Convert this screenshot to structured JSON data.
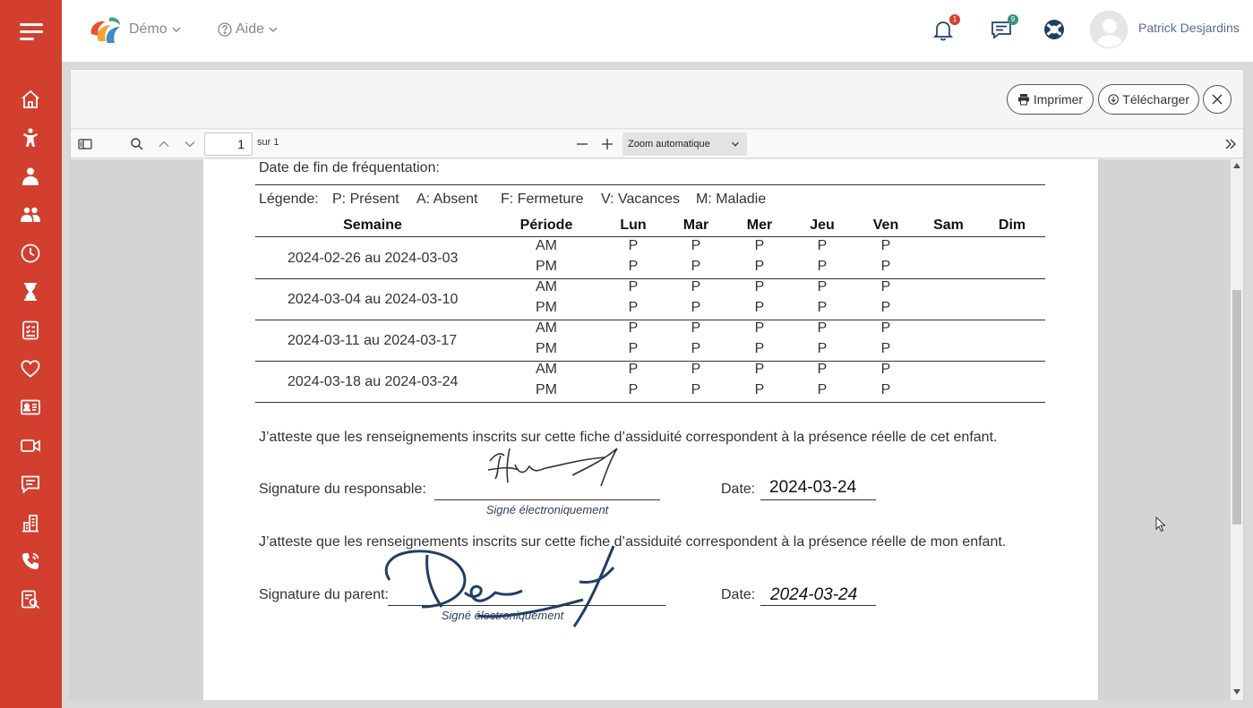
{
  "header": {
    "demo_label": "Démo",
    "help_label": "Aide",
    "notifications_badge": "1",
    "messages_badge": "9",
    "user_name": "Patrick Desjardins"
  },
  "viewer": {
    "print_label": "Imprimer",
    "download_label": "Télécharger",
    "page_number": "1",
    "page_of": "sur 1",
    "zoom_value": "Zoom automatique"
  },
  "document": {
    "end_date_label": "Date de fin de fréquentation:",
    "legend": [
      "Légende:",
      "P: Présent",
      "A: Absent",
      "F: Fermeture",
      "V: Vacances",
      "M: Maladie"
    ],
    "columns": [
      "Semaine",
      "Période",
      "Lun",
      "Mar",
      "Mer",
      "Jeu",
      "Ven",
      "Sam",
      "Dim"
    ],
    "weeks": [
      {
        "label": "2024-02-26 au 2024-03-03",
        "rows": [
          [
            "AM",
            "P",
            "P",
            "P",
            "P",
            "P",
            "",
            ""
          ],
          [
            "PM",
            "P",
            "P",
            "P",
            "P",
            "P",
            "",
            ""
          ]
        ]
      },
      {
        "label": "2024-03-04 au 2024-03-10",
        "rows": [
          [
            "AM",
            "P",
            "P",
            "P",
            "P",
            "P",
            "",
            ""
          ],
          [
            "PM",
            "P",
            "P",
            "P",
            "P",
            "P",
            "",
            ""
          ]
        ]
      },
      {
        "label": "2024-03-11 au 2024-03-17",
        "rows": [
          [
            "AM",
            "P",
            "P",
            "P",
            "P",
            "P",
            "",
            ""
          ],
          [
            "PM",
            "P",
            "P",
            "P",
            "P",
            "P",
            "",
            ""
          ]
        ]
      },
      {
        "label": "2024-03-18 au 2024-03-24",
        "rows": [
          [
            "AM",
            "P",
            "P",
            "P",
            "P",
            "P",
            "",
            ""
          ],
          [
            "PM",
            "P",
            "P",
            "P",
            "P",
            "P",
            "",
            ""
          ]
        ]
      }
    ],
    "attest_responsible": "J’atteste que les renseignements inscrits sur cette fiche d’assiduité correspondent à la présence réelle de cet enfant.",
    "sig_responsible_label": "Signature du responsable:",
    "electronic_note": "Signé électroniquement",
    "date_label": "Date:",
    "date_responsible": "2024-03-24",
    "attest_parent": "J’atteste que les renseignements inscrits sur cette fiche d’assiduité correspondent à la présence réelle de mon enfant.",
    "sig_parent_label": "Signature du parent:",
    "date_parent": "2024-03-24"
  },
  "colors": {
    "sidebar": "#d23f2f",
    "notification_badge": "#d23f2f",
    "message_badge": "#3a8f7a",
    "signature_ink": "#1f3f66"
  }
}
